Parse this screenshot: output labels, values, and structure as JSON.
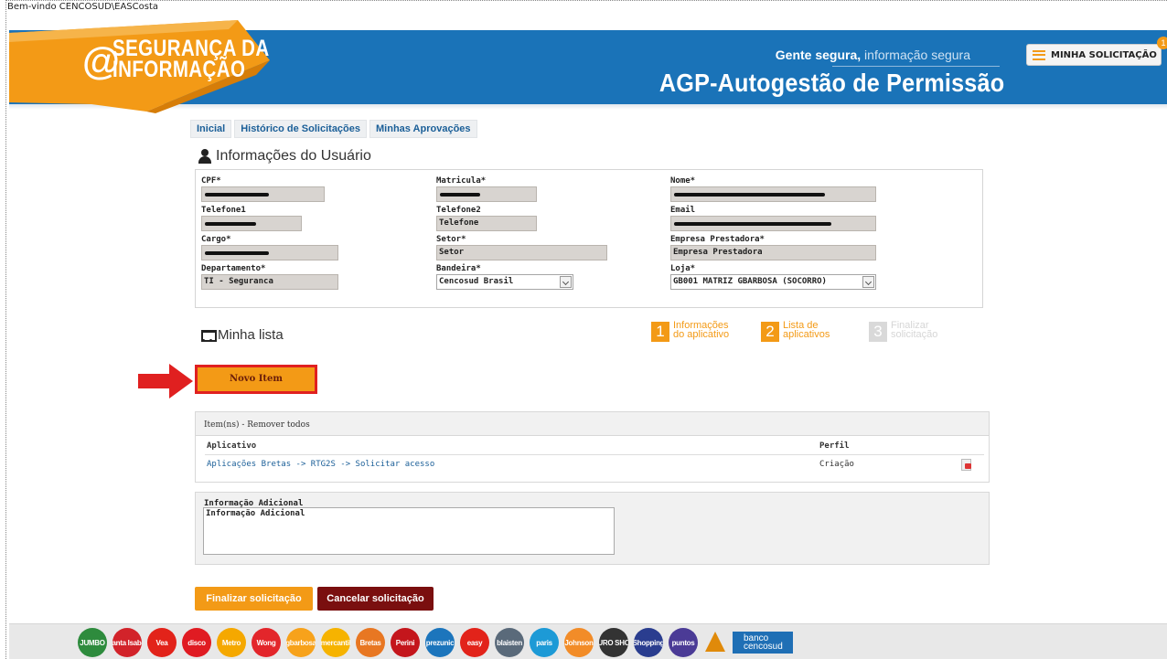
{
  "window": {
    "welcome": "Bem-vindo CENCOSUD\\EASCosta"
  },
  "header": {
    "logo_line1": "SEGURANÇA DA",
    "logo_line2": "INFORMAÇÃO",
    "logo_at": "@",
    "tagline_bold": "Gente segura,",
    "tagline_rest": " informação segura",
    "title": "AGP-Autogestão de Permissão",
    "minha_label": "MINHA SOLICITAÇÃO",
    "badge_count": "1",
    "brand_orange": "#f39a16",
    "brand_blue": "#1a73b8"
  },
  "tabs": [
    {
      "label": "Inicial"
    },
    {
      "label": "Histórico de Solicitações"
    },
    {
      "label": "Minhas Aprovações"
    }
  ],
  "user_section": {
    "title": "Informações do Usuário",
    "fields": {
      "cpf": {
        "label": "CPF*",
        "value": ""
      },
      "matricula": {
        "label": "Matricula*",
        "value": ""
      },
      "nome": {
        "label": "Nome*",
        "value": ""
      },
      "telefone1": {
        "label": "Telefone1",
        "value": ""
      },
      "telefone2": {
        "label": "Telefone2",
        "value": "Telefone"
      },
      "email": {
        "label": "Email",
        "value": ""
      },
      "cargo": {
        "label": "Cargo*",
        "value": ""
      },
      "setor": {
        "label": "Setor*",
        "value": "Setor"
      },
      "empresa": {
        "label": "Empresa Prestadora*",
        "value": "Empresa Prestadora"
      },
      "departamento": {
        "label": "Departamento*",
        "value": "TI - Seguranca"
      },
      "bandeira": {
        "label": "Bandeira*",
        "value": "Cencosud Brasil"
      },
      "loja": {
        "label": "Loja*",
        "value": "GB001 MATRIZ GBARBOSA (SOCORRO)"
      }
    }
  },
  "lista": {
    "title": "Minha lista",
    "novo_item": "Novo Item",
    "steps": [
      {
        "num": "1",
        "line1": "Informações",
        "line2": "do aplicativo"
      },
      {
        "num": "2",
        "line1": "Lista de",
        "line2": "aplicativos"
      },
      {
        "num": "3",
        "line1": "Finalizar",
        "line2": "solicitação"
      }
    ]
  },
  "items": {
    "header": "Item(ns) - Remover todos",
    "columns": [
      "Aplicativo",
      "Perfil"
    ],
    "rows": [
      {
        "aplicativo": "Aplicações Bretas -> RTG2S -> Solicitar acesso",
        "perfil": "Criação"
      }
    ]
  },
  "info": {
    "label": "Informação Adicional",
    "value": "Informação Adicional"
  },
  "actions": {
    "finalizar": "Finalizar solicitação",
    "cancelar": "Cancelar solicitação"
  },
  "footer": {
    "brands": [
      {
        "name": "JUMBO",
        "color": "#2e8b3d"
      },
      {
        "name": "Santa Isabel",
        "color": "#d2232a"
      },
      {
        "name": "Vea",
        "color": "#e2231a"
      },
      {
        "name": "disco",
        "color": "#e01b22"
      },
      {
        "name": "Metro",
        "color": "#f5a800"
      },
      {
        "name": "Wong",
        "color": "#e3262b"
      },
      {
        "name": "gbarbosa",
        "color": "#f7a21b"
      },
      {
        "name": "mercantil",
        "color": "#f6b300"
      },
      {
        "name": "Bretas",
        "color": "#e87722"
      },
      {
        "name": "Perini",
        "color": "#c4161c"
      },
      {
        "name": "prezunic",
        "color": "#1c75bc"
      },
      {
        "name": "easy",
        "color": "#e2231a"
      },
      {
        "name": "blaisten",
        "color": "#5a6a7a"
      },
      {
        "name": "paris",
        "color": "#1d9ad6"
      },
      {
        "name": "Johnson",
        "color": "#f28c28"
      },
      {
        "name": "EURO SHOP",
        "color": "#333333"
      },
      {
        "name": "Shopping",
        "color": "#2a3d8f"
      },
      {
        "name": "puntos",
        "color": "#4b3b96"
      }
    ],
    "banco": "banco cencosud"
  }
}
